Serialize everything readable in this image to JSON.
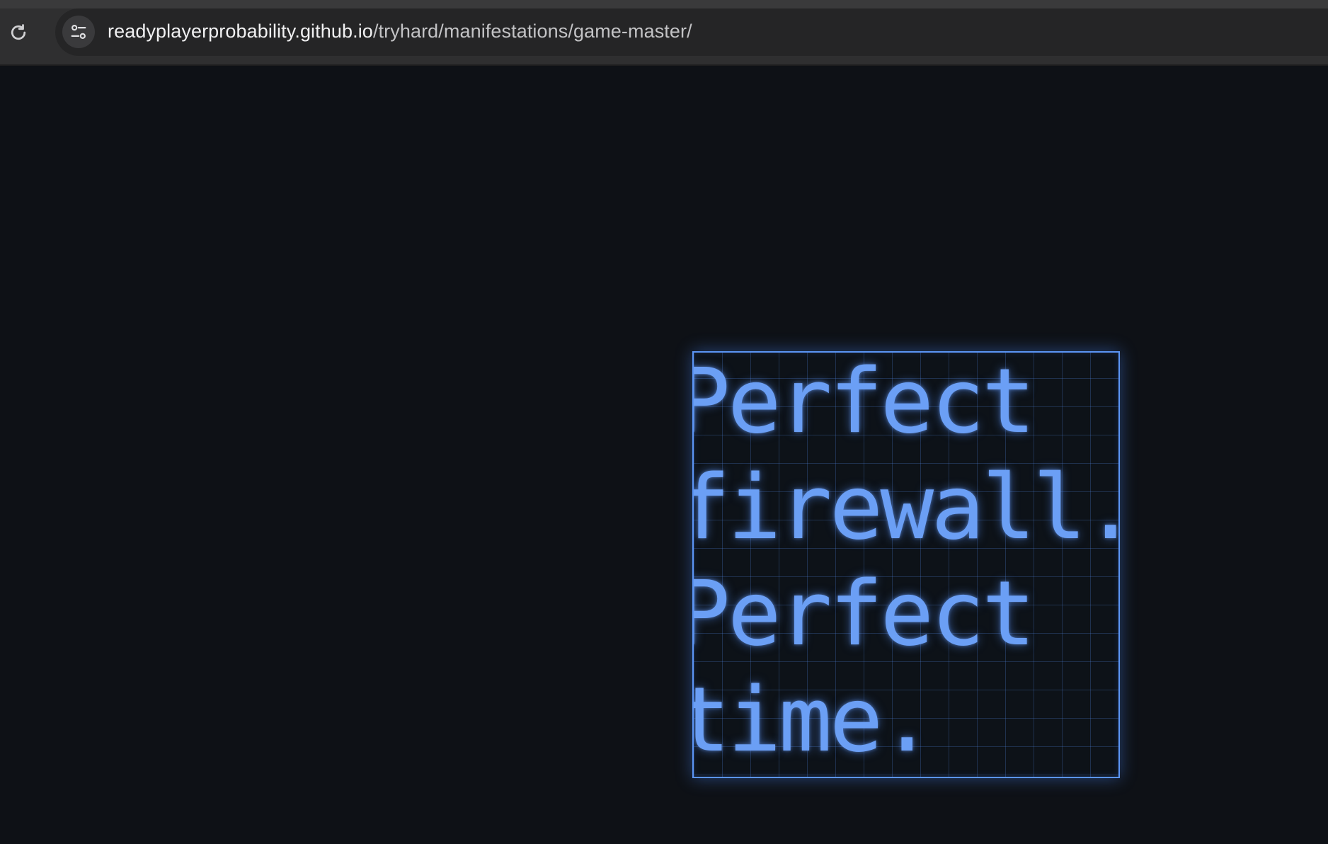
{
  "browser": {
    "url_host": "readyplayerprobability.github.io",
    "url_path": "/tryhard/manifestations/game-master/",
    "icons": {
      "reload": "reload-icon",
      "site_info": "tune-icon"
    }
  },
  "page": {
    "background_color": "#0e1116",
    "glyph_box": {
      "accent_color": "#5b95f5",
      "lines": [
        "Perfect",
        "firewall.",
        "Perfect",
        "time."
      ]
    }
  }
}
